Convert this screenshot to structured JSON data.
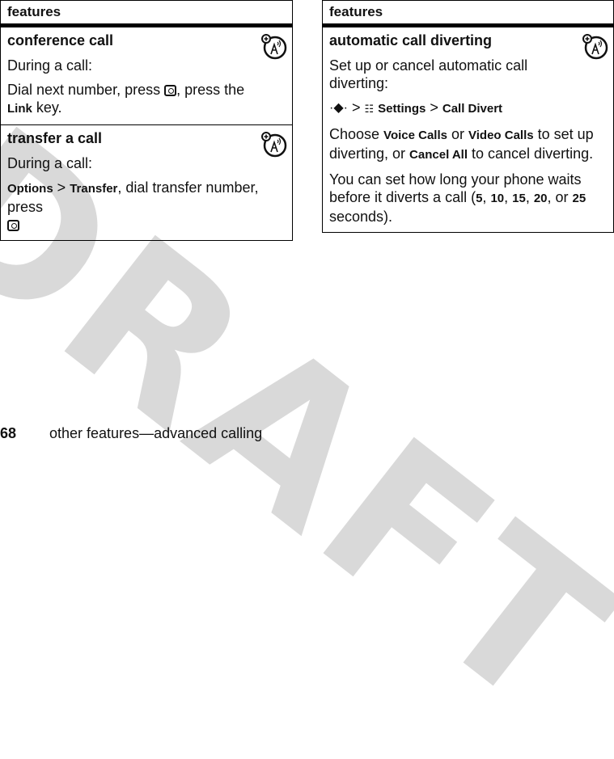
{
  "watermark": "DRAFT",
  "left_table": {
    "header": "features",
    "rows": [
      {
        "title": "conference call",
        "lines": {
          "p1": "During a call:",
          "p2_a": "Dial next number, press ",
          "p2_b": ", press the ",
          "p2_key": "Link",
          "p2_c": " key."
        }
      },
      {
        "title": "transfer a call",
        "lines": {
          "p1": "During a call:",
          "p2_key1": "Options",
          "p2_sep": " > ",
          "p2_key2": "Transfer",
          "p2_a": ", dial transfer number, press"
        }
      }
    ]
  },
  "right_table": {
    "header": "features",
    "rows": [
      {
        "title": "automatic call diverting",
        "lines": {
          "p1": "Set up or cancel automatic call diverting:",
          "nav_glyph": "·◆·",
          "sep": " > ",
          "settings_glyph": "☷",
          "key1": "Settings",
          "key2": "Call Divert",
          "p3_a": "Choose ",
          "p3_k1": "Voice Calls",
          "p3_b": " or ",
          "p3_k2": "Video Calls",
          "p3_c": " to set up diverting, or ",
          "p3_k3": "Cancel All",
          "p3_d": " to cancel diverting.",
          "p4_a": "You can set how long your phone waits before it diverts a call (",
          "p4_v1": "5",
          "p4_v2": "10",
          "p4_v3": "15",
          "p4_v4": "20",
          "p4_v5": "25",
          "comma": ", ",
          "or": ", or ",
          "p4_end": " seconds)."
        }
      }
    ]
  },
  "footer": {
    "page_number": "68",
    "section": "other features—advanced calling"
  }
}
